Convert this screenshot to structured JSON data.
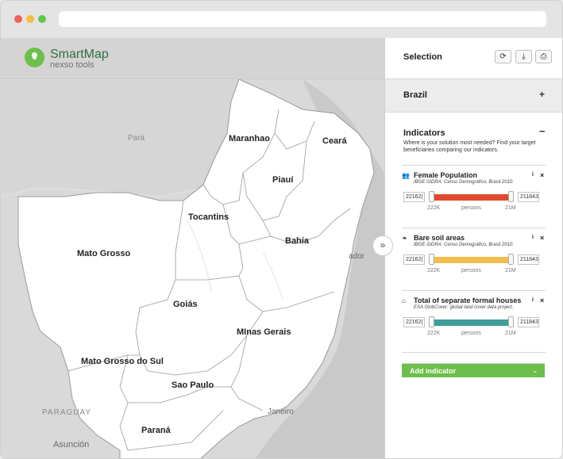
{
  "app": {
    "name": "SmartMap",
    "subtitle": "nexso tools"
  },
  "map": {
    "regions": [
      "Maranhao",
      "Ceará",
      "Piauí",
      "Tocantins",
      "Bahía",
      "Mato Grosso",
      "Goiás",
      "MInas Gerais",
      "Mato Grosso do Sul",
      "Sao Paulo",
      "Paraná"
    ],
    "external_labels": [
      "Pará",
      "PARAGUAY",
      "Asunción",
      "Janeiro",
      "ador"
    ],
    "collapse_icon": "double-chevron-right-icon"
  },
  "panel": {
    "selection_title": "Selection",
    "tools": [
      "refresh-icon",
      "download-icon",
      "print-icon"
    ],
    "country": "Brazil",
    "country_toggle": "+",
    "indicators_title": "Indicators",
    "indicators_toggle": "−",
    "indicators_description": "Where is your solution most needed? Find your target beneficiaries comparing our indicators.",
    "cards": [
      {
        "icon": "people-icon",
        "title": "Female Population",
        "source": "IBGE-SIDRA: Censo Demográfico, Brasil 2010.",
        "min_value": "22162(",
        "max_value": "211843",
        "scale_min": "222K",
        "scale_unit": "persons",
        "scale_max": "21M",
        "color": "#e04a2c"
      },
      {
        "icon": "leaf-icon",
        "title": "Bare soil areas",
        "source": "IBGE-SIDRA: Censo Demográfico, Brasil 2010.",
        "min_value": "22162(",
        "max_value": "211843",
        "scale_min": "222K",
        "scale_unit": "persons",
        "scale_max": "21M",
        "color": "#f1bd4c"
      },
      {
        "icon": "house-icon",
        "title": "Total of separate formal houses",
        "source": "ESA GlobCover: global land cover data project.",
        "min_value": "22162(",
        "max_value": "211843",
        "scale_min": "222K",
        "scale_unit": "persons",
        "scale_max": "21M",
        "color": "#3f9d9a"
      }
    ],
    "info_label": "i",
    "close_label": "×",
    "add_indicator": "Add indicator",
    "add_chevron": "⌄"
  }
}
